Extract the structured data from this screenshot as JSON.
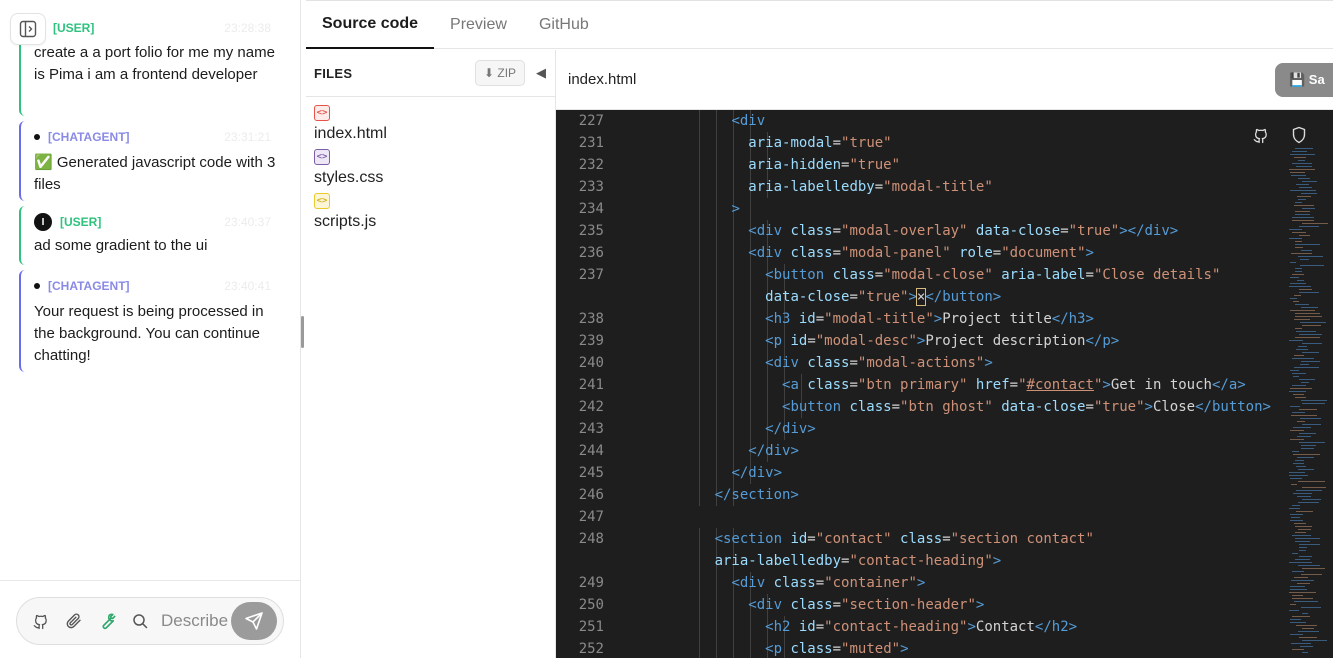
{
  "chat": {
    "messages": [
      {
        "role": "[USER]",
        "time": "23:28:38",
        "text": "create a a port folio for me my name is Pima i am a frontend developer",
        "kind": "user"
      },
      {
        "role": "[CHATAGENT]",
        "time": "23:31:21",
        "text": "✅ Generated javascript code with 3 files",
        "kind": "agent"
      },
      {
        "role": "[USER]",
        "time": "23:40:37",
        "text": "ad some gradient to the ui",
        "kind": "user",
        "avatar": "I"
      },
      {
        "role": "[CHATAGENT]",
        "time": "23:40:41",
        "text": "Your request is being processed in the background. You can continue chatting!",
        "kind": "agent"
      }
    ],
    "composer": {
      "placeholder": "Describe"
    }
  },
  "tabs": [
    "Source code",
    "Preview",
    "GitHub"
  ],
  "files": {
    "title": "FILES",
    "zip_label": "⬇ ZIP",
    "collapse": "◀",
    "items": [
      {
        "name": "index.html",
        "icon": "html-file-icon",
        "color": "#e5534b"
      },
      {
        "name": "styles.css",
        "icon": "css-file-icon",
        "color": "#7b5ea7"
      },
      {
        "name": "scripts.js",
        "icon": "js-file-icon",
        "color": "#e8c92e"
      }
    ]
  },
  "editor": {
    "filename": "index.html",
    "save_label": "💾 Sa"
  },
  "code_lines": [
    {
      "n": "227",
      "indent": 8,
      "tokens": [
        [
          "t-tag",
          "<div"
        ]
      ]
    },
    {
      "n": "231",
      "indent": 9,
      "tokens": [
        [
          "t-attr",
          "aria-modal"
        ],
        [
          "t-txt",
          "="
        ],
        [
          "t-str",
          "\"true\""
        ]
      ]
    },
    {
      "n": "232",
      "indent": 9,
      "tokens": [
        [
          "t-attr",
          "aria-hidden"
        ],
        [
          "t-txt",
          "="
        ],
        [
          "t-str",
          "\"true\""
        ]
      ]
    },
    {
      "n": "233",
      "indent": 9,
      "tokens": [
        [
          "t-attr",
          "aria-labelledby"
        ],
        [
          "t-txt",
          "="
        ],
        [
          "t-str",
          "\"modal-title\""
        ]
      ]
    },
    {
      "n": "234",
      "indent": 8,
      "tokens": [
        [
          "t-tag",
          ">"
        ]
      ]
    },
    {
      "n": "235",
      "indent": 9,
      "tokens": [
        [
          "t-tag",
          "<div "
        ],
        [
          "t-attr",
          "class"
        ],
        [
          "t-txt",
          "="
        ],
        [
          "t-str",
          "\"modal-overlay\" "
        ],
        [
          "t-attr",
          "data-close"
        ],
        [
          "t-txt",
          "="
        ],
        [
          "t-str",
          "\"true\""
        ],
        [
          "t-tag",
          "></div>"
        ]
      ]
    },
    {
      "n": "236",
      "indent": 9,
      "tokens": [
        [
          "t-tag",
          "<div "
        ],
        [
          "t-attr",
          "class"
        ],
        [
          "t-txt",
          "="
        ],
        [
          "t-str",
          "\"modal-panel\" "
        ],
        [
          "t-attr",
          "role"
        ],
        [
          "t-txt",
          "="
        ],
        [
          "t-str",
          "\"document\""
        ],
        [
          "t-tag",
          ">"
        ]
      ]
    },
    {
      "n": "237",
      "indent": 10,
      "tokens": [
        [
          "t-tag",
          "<button "
        ],
        [
          "t-attr",
          "class"
        ],
        [
          "t-txt",
          "="
        ],
        [
          "t-str",
          "\"modal-close\" "
        ],
        [
          "t-attr",
          "aria-label"
        ],
        [
          "t-txt",
          "="
        ],
        [
          "t-str",
          "\"Close details\""
        ]
      ]
    },
    {
      "n": "",
      "indent": 10,
      "tokens": [
        [
          "t-attr",
          "data-close"
        ],
        [
          "t-txt",
          "="
        ],
        [
          "t-str",
          "\"true\""
        ],
        [
          "t-tag",
          ">"
        ],
        [
          "t-txt curword",
          "×"
        ],
        [
          "t-tag",
          "</button>"
        ]
      ]
    },
    {
      "n": "238",
      "indent": 10,
      "tokens": [
        [
          "t-tag",
          "<h3 "
        ],
        [
          "t-attr",
          "id"
        ],
        [
          "t-txt",
          "="
        ],
        [
          "t-str",
          "\"modal-title\""
        ],
        [
          "t-tag",
          ">"
        ],
        [
          "t-txt",
          "Project title"
        ],
        [
          "t-tag",
          "</h3>"
        ]
      ]
    },
    {
      "n": "239",
      "indent": 10,
      "tokens": [
        [
          "t-tag",
          "<p "
        ],
        [
          "t-attr",
          "id"
        ],
        [
          "t-txt",
          "="
        ],
        [
          "t-str",
          "\"modal-desc\""
        ],
        [
          "t-tag",
          ">"
        ],
        [
          "t-txt",
          "Project description"
        ],
        [
          "t-tag",
          "</p>"
        ]
      ]
    },
    {
      "n": "240",
      "indent": 10,
      "tokens": [
        [
          "t-tag",
          "<div "
        ],
        [
          "t-attr",
          "class"
        ],
        [
          "t-txt",
          "="
        ],
        [
          "t-str",
          "\"modal-actions\""
        ],
        [
          "t-tag",
          ">"
        ]
      ]
    },
    {
      "n": "241",
      "indent": 11,
      "tokens": [
        [
          "t-tag",
          "<a "
        ],
        [
          "t-attr",
          "class"
        ],
        [
          "t-txt",
          "="
        ],
        [
          "t-str",
          "\"btn primary\" "
        ],
        [
          "t-attr",
          "href"
        ],
        [
          "t-txt",
          "="
        ],
        [
          "t-str",
          "\""
        ],
        [
          "t-str link-u",
          "#contact"
        ],
        [
          "t-str",
          "\""
        ],
        [
          "t-tag",
          ">"
        ],
        [
          "t-txt",
          "Get in touch"
        ],
        [
          "t-tag",
          "</a>"
        ]
      ]
    },
    {
      "n": "242",
      "indent": 11,
      "tokens": [
        [
          "t-tag",
          "<button "
        ],
        [
          "t-attr",
          "class"
        ],
        [
          "t-txt",
          "="
        ],
        [
          "t-str",
          "\"btn ghost\" "
        ],
        [
          "t-attr",
          "data-close"
        ],
        [
          "t-txt",
          "="
        ],
        [
          "t-str",
          "\"true\""
        ],
        [
          "t-tag",
          ">"
        ],
        [
          "t-txt",
          "Close"
        ],
        [
          "t-tag",
          "</button>"
        ]
      ]
    },
    {
      "n": "243",
      "indent": 10,
      "tokens": [
        [
          "t-tag",
          "</div>"
        ]
      ]
    },
    {
      "n": "244",
      "indent": 9,
      "tokens": [
        [
          "t-tag",
          "</div>"
        ]
      ]
    },
    {
      "n": "245",
      "indent": 8,
      "tokens": [
        [
          "t-tag",
          "</div>"
        ]
      ]
    },
    {
      "n": "246",
      "indent": 7,
      "tokens": [
        [
          "t-tag",
          "</section>"
        ]
      ]
    },
    {
      "n": "247",
      "indent": 0,
      "tokens": []
    },
    {
      "n": "248",
      "indent": 7,
      "tokens": [
        [
          "t-tag",
          "<section "
        ],
        [
          "t-attr",
          "id"
        ],
        [
          "t-txt",
          "="
        ],
        [
          "t-str",
          "\"contact\" "
        ],
        [
          "t-attr",
          "class"
        ],
        [
          "t-txt",
          "="
        ],
        [
          "t-str",
          "\"section contact\""
        ]
      ]
    },
    {
      "n": "",
      "indent": 7,
      "tokens": [
        [
          "t-attr",
          "aria-labelledby"
        ],
        [
          "t-txt",
          "="
        ],
        [
          "t-str",
          "\"contact-heading\""
        ],
        [
          "t-tag",
          ">"
        ]
      ]
    },
    {
      "n": "249",
      "indent": 8,
      "tokens": [
        [
          "t-tag",
          "<div "
        ],
        [
          "t-attr",
          "class"
        ],
        [
          "t-txt",
          "="
        ],
        [
          "t-str",
          "\"container\""
        ],
        [
          "t-tag",
          ">"
        ]
      ]
    },
    {
      "n": "250",
      "indent": 9,
      "tokens": [
        [
          "t-tag",
          "<div "
        ],
        [
          "t-attr",
          "class"
        ],
        [
          "t-txt",
          "="
        ],
        [
          "t-str",
          "\"section-header\""
        ],
        [
          "t-tag",
          ">"
        ]
      ]
    },
    {
      "n": "251",
      "indent": 10,
      "tokens": [
        [
          "t-tag",
          "<h2 "
        ],
        [
          "t-attr",
          "id"
        ],
        [
          "t-txt",
          "="
        ],
        [
          "t-str",
          "\"contact-heading\""
        ],
        [
          "t-tag",
          ">"
        ],
        [
          "t-txt",
          "Contact"
        ],
        [
          "t-tag",
          "</h2>"
        ]
      ]
    },
    {
      "n": "252",
      "indent": 10,
      "tokens": [
        [
          "t-tag",
          "<p "
        ],
        [
          "t-attr",
          "class"
        ],
        [
          "t-txt",
          "="
        ],
        [
          "t-str",
          "\"muted\""
        ],
        [
          "t-tag",
          ">"
        ]
      ]
    }
  ]
}
